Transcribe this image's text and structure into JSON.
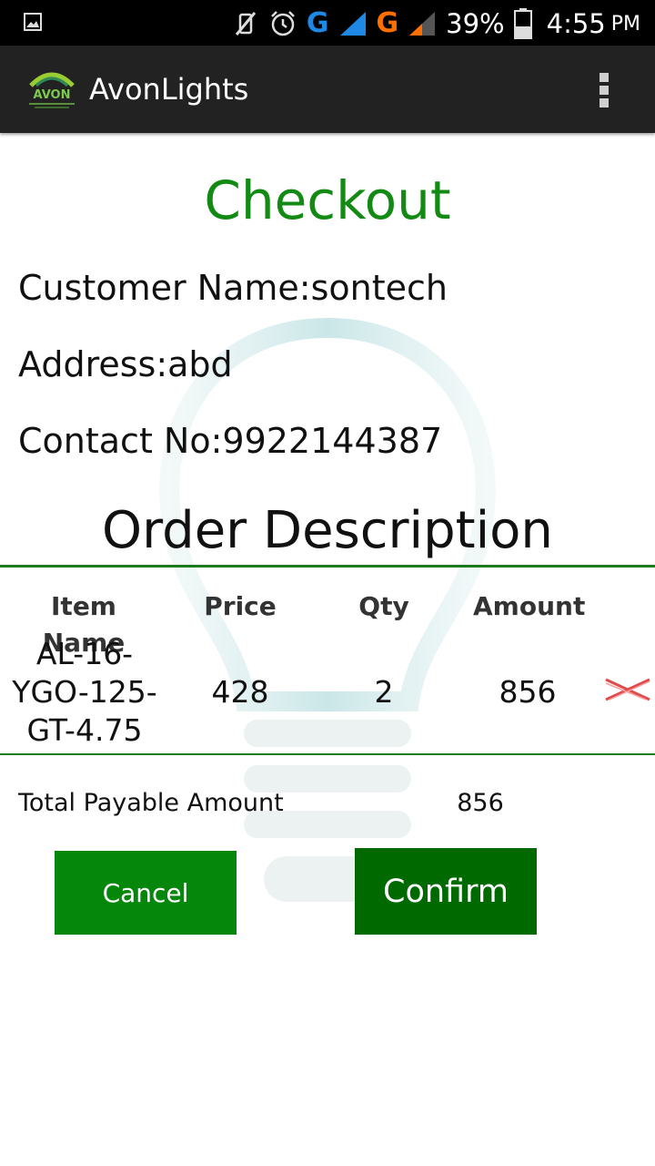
{
  "status_bar": {
    "network_1": "G",
    "network_2": "G",
    "battery": "39%",
    "time": "4:55",
    "ampm": "PM",
    "colors": {
      "network_1": "#1e88e5",
      "network_2": "#ff6f00"
    }
  },
  "app_bar": {
    "title": "AvonLights",
    "logo_text": "AVON"
  },
  "checkout": {
    "title": "Checkout",
    "customer_name": "Customer Name:sontech",
    "address": "Address:abd",
    "contact": "Contact No:9922144387"
  },
  "order": {
    "title": "Order Description",
    "headers": [
      "Item Name",
      "Price",
      "Qty",
      "Amount"
    ],
    "rows": [
      {
        "item_lines": [
          "AL-16-",
          "YGO-125-",
          "GT-4.75"
        ],
        "price": "428",
        "qty": "2",
        "amount": "856"
      }
    ]
  },
  "total": {
    "label": "Total Payable Amount",
    "value": "856"
  },
  "actions": {
    "cancel": "Cancel",
    "confirm": "Confirm"
  },
  "colors": {
    "accent_green": "#138a13",
    "cancel_button": "#05870b",
    "confirm_button": "#006a00",
    "delete_icon": "#e04a4a"
  }
}
